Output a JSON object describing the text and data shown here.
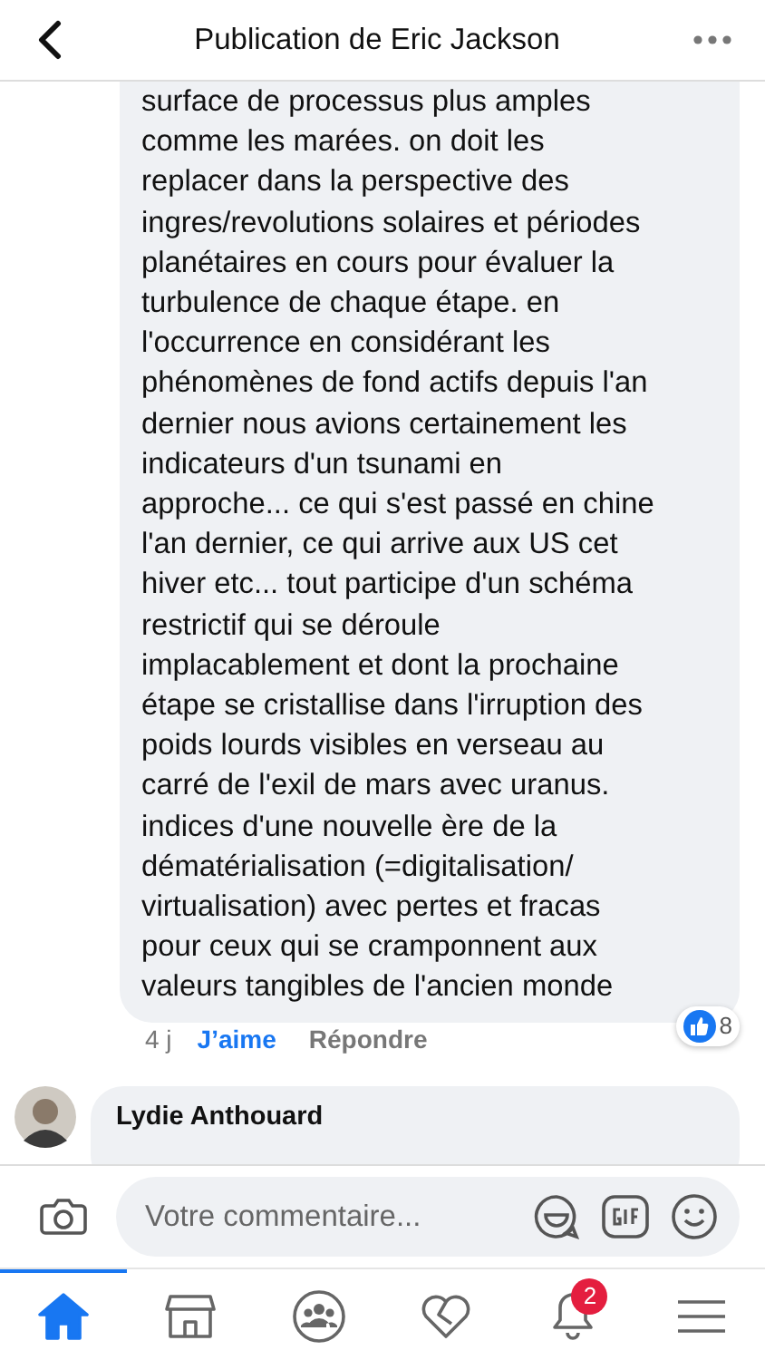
{
  "header": {
    "title": "Publication de Eric Jackson"
  },
  "comment": {
    "text": "surface de processus plus amples\ncomme les marées. on doit les\nreplacer dans la perspective des\ningres/revolutions solaires et périodes\nplanétaires en cours pour évaluer la\nturbulence de chaque étape. en\nl'occurrence en considérant les\nphénomènes de fond actifs depuis l'an\ndernier nous avions certainement les\nindicateurs d'un tsunami en\napproche... ce qui s'est passé en chine\nl'an dernier, ce qui arrive aux US cet\nhiver etc... tout participe d'un schéma\nrestrictif qui se déroule\nimplacablement et dont la prochaine\nétape se cristallise dans l'irruption des\npoids lourds visibles en verseau au\ncarré de l'exil de mars avec uranus.\nindices d'une nouvelle ère de la\ndématérialisation (=digitalisation/\nvirtualisation) avec pertes et fracas\npour ceux qui se cramponnent aux\nvaleurs tangibles de l'ancien monde",
    "time": "4 j",
    "like": {
      "label": "J’aime",
      "liked": true
    },
    "reply": "Répondre",
    "reactions": "8"
  },
  "next_comment": {
    "author": "Lydie Anthouard"
  },
  "composer": {
    "placeholder": "Votre commentaire..."
  },
  "tabs": [
    {
      "kind": "home",
      "selected": true
    },
    {
      "kind": "shop",
      "selected": false
    },
    {
      "kind": "groups",
      "selected": false
    },
    {
      "kind": "dating",
      "selected": false
    },
    {
      "kind": "notifications",
      "selected": false,
      "badge": "2"
    },
    {
      "kind": "menu",
      "selected": false
    }
  ]
}
